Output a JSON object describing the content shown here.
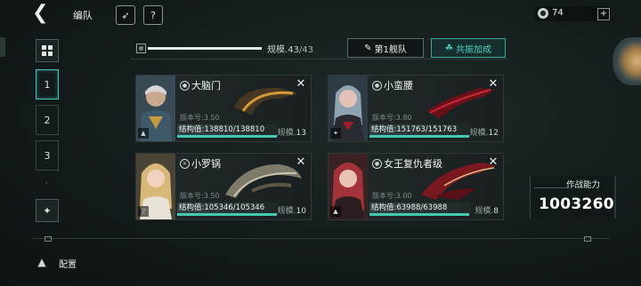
{
  "topbar": {
    "title": "编队",
    "resource_value": "74",
    "resource_plus": "+"
  },
  "sidebar": {
    "fleets": [
      "1",
      "2",
      "3"
    ],
    "active_fleet": "1",
    "more": "."
  },
  "scale": {
    "label": "规模.",
    "current": "43",
    "max": "/43",
    "progress": 1.0
  },
  "buttons": {
    "fleet": "第1舰队",
    "resonance": "共振加成"
  },
  "ships": [
    {
      "name": "大脑门",
      "version": "版本号:3.50",
      "structure": "结构值:138810/138810",
      "scale_label": "规模.",
      "scale": "13",
      "struct_ratio": 1.0
    },
    {
      "name": "小蛮腰",
      "version": "版本号:3.80",
      "structure": "结构值:151763/151763",
      "scale_label": "规模.",
      "scale": "12",
      "struct_ratio": 1.0
    },
    {
      "name": "小罗锅",
      "version": "版本号:3.50",
      "structure": "结构值:105346/105346",
      "scale_label": "规模.",
      "scale": "10",
      "struct_ratio": 1.0
    },
    {
      "name": "女王复仇者级",
      "version": "版本号:3.00",
      "structure": "结构值:63988/63988",
      "scale_label": "规模.",
      "scale": "8",
      "struct_ratio": 1.0
    }
  ],
  "power": {
    "label": "作战能力",
    "value": "1003260"
  },
  "bottom": {
    "config_label": "配置"
  },
  "colors": {
    "accent": "#43c9b6",
    "background": "#141b1c"
  }
}
